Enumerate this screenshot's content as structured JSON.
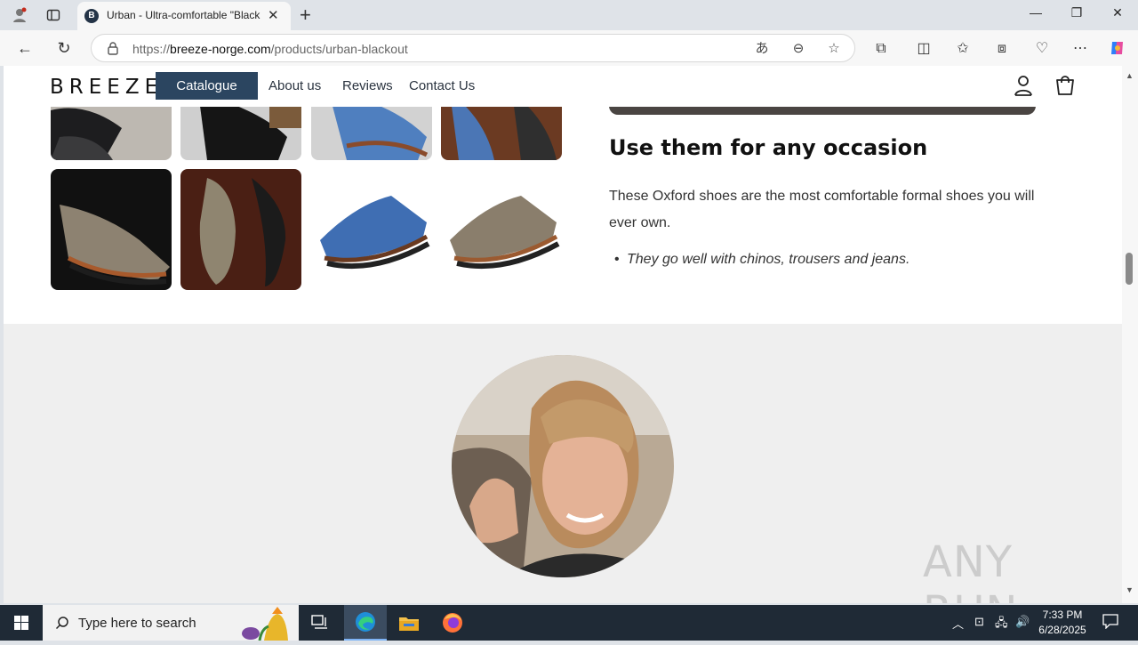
{
  "browser": {
    "tab_title": "Urban - Ultra-comfortable \"Black",
    "tab_favicon_letter": "B",
    "url_prefix": "https://",
    "url_domain": "breeze-norge.com",
    "url_path": "/products/urban-blackout"
  },
  "site": {
    "brand": "BREEZE",
    "nav": {
      "catalogue": "Catalogue",
      "about": "About us",
      "reviews": "Reviews",
      "contact": "Contact Us"
    }
  },
  "content": {
    "heading": "Use them for any occasion",
    "paragraph": "These Oxford shoes are the most comfortable formal shoes you will ever own.",
    "bullet": "They go well with chinos, trousers and jeans."
  },
  "watermark": "ANY RUN",
  "taskbar": {
    "search_placeholder": "Type here to search",
    "time": "7:33 PM",
    "date": "6/28/2025"
  },
  "colors": {
    "brand_button": "#2b4560",
    "taskbar": "#1f2a36",
    "grey_section": "#efefef"
  }
}
